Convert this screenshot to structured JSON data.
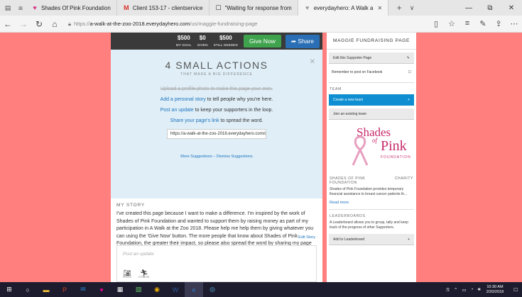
{
  "browser": {
    "tabs": [
      {
        "label": "Shades Of Pink Foundation",
        "favicon": "pink-ribbon-icon"
      },
      {
        "label": "Client 153-17 - clientservice",
        "favicon": "gmail-icon"
      },
      {
        "label": "\"Waiting for response from",
        "favicon": "document-icon"
      },
      {
        "label": "everydayhero: A Walk a",
        "favicon": "heart-icon"
      }
    ],
    "new_tab": "+",
    "tab_menu": "∨",
    "win_min": "—",
    "win_max": "⧉",
    "win_close": "✕",
    "url_prefix": "https://",
    "url_domain": "a-walk-at-the-zoo-2018.everydayhero.com",
    "url_path": "/us/maggie-fundraising-page"
  },
  "topbar": {
    "goal_value": "$500",
    "goal_label": "MY GOAL",
    "given_value": "$0",
    "given_label": "GIVEN",
    "needed_value": "$500",
    "needed_label": "STILL NEEDED",
    "give_label": "Give Now",
    "share_label": "Share"
  },
  "actions": {
    "title": "4 SMALL ACTIONS",
    "subtitle": "THAT MAKE A BIG DIFFERENCE",
    "close": "✕",
    "item1": "Upload a profile photo to make this page your own.",
    "item2_link": "Add a personal story",
    "item2_rest": " to tell people why you're here.",
    "item3_link": "Post an update",
    "item3_rest": " to keep your supporters in the loop.",
    "item4_link": "Share your page's link",
    "item4_rest": " to spread the word.",
    "share_url": "https://a-walk-at-the-zoo-2018.everydayhero.com/us/n",
    "more": "More Suggestions – Dismiss Suggestions"
  },
  "story": {
    "heading": "MY STORY",
    "body": "I've created this page because I want to make a difference. I'm inspired by the work of Shades of Pink Foundation and wanted to support them by raising money as part of my participation in A Walk at the Zoo 2018. Please help me help them by giving whatever you can using the 'Give Now' button. The more people that know about Shades of Pink Foundation, the greater their impact, so please also spread the word by sharing my page with your friends and family. Thank you in advance for your generosity, it means a lot!",
    "edit": "Edit Story"
  },
  "post": {
    "placeholder": "Post an update",
    "photo": "PHOTO",
    "fitness": "FITNESS"
  },
  "sidebar": {
    "page_name": "MAGGIE FUNDRAISING PAGE",
    "edit_page": "Edit this Supporter Page",
    "remember": "Remember to post on Facebook",
    "team_label": "TEAM",
    "create_team": "Create a new team",
    "join_team": "Join an existing team",
    "logo_line1": "Shades",
    "logo_of": "of",
    "logo_line2": "Pink",
    "logo_sub": "FOUNDATION",
    "charity_name": "SHADES OF PINK FOUNDATION",
    "charity_tag": "CHARITY",
    "charity_desc": "Shades of Pink Foundation provides temporary financial assistance to breast cancer patients th...",
    "read_more": "Read more",
    "leaderboards_label": "LEADERBOARDS",
    "leaderboards_desc": "A Leaderboard allows you to group, tally and keep track of the progress of other Supporters.",
    "add_leaderboard": "Add to Leaderboard"
  },
  "taskbar": {
    "time": "10:30 AM",
    "date": "2/20/2018"
  },
  "colors": {
    "background": "#ff7f7f",
    "give_green": "#3fa34d",
    "share_blue": "#2a6fb5",
    "team_blue": "#0f8fd2",
    "brand_pink": "#c72a6a"
  }
}
